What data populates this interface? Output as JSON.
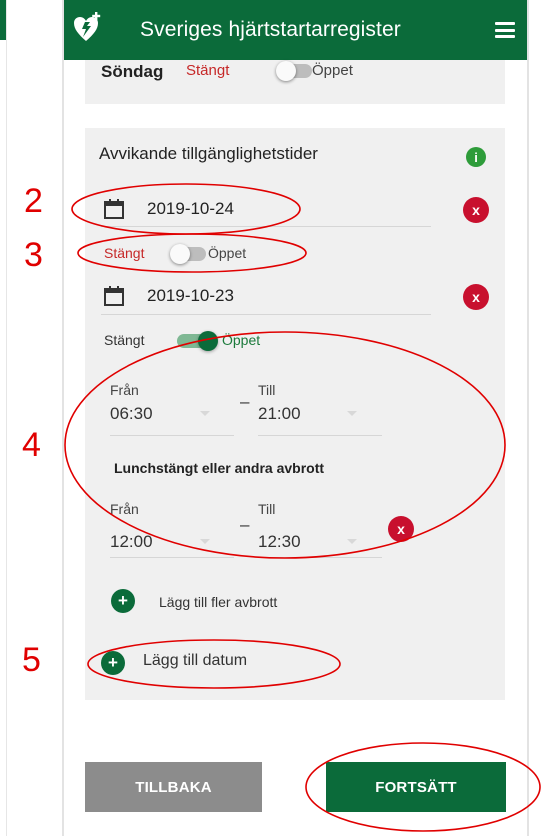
{
  "header": {
    "title": "Sveriges hjärtstartarregister"
  },
  "sunday": {
    "day": "Söndag",
    "closed": "Stängt",
    "open": "Öppet"
  },
  "deviating": {
    "heading": "Avvikande tillgänglighetstider",
    "entry1": {
      "date": "2019-10-24",
      "closed": "Stängt",
      "open": "Öppet"
    },
    "entry2": {
      "date": "2019-10-23",
      "closed": "Stängt",
      "open": "Öppet",
      "from_label": "Från",
      "from_value": "06:30",
      "to_label": "Till",
      "to_value": "21:00",
      "lunch_heading": "Lunchstängt eller andra avbrott",
      "break_from_label": "Från",
      "break_from_value": "12:00",
      "break_to_label": "Till",
      "break_to_value": "12:30",
      "add_break": "Lägg till fler avbrott"
    },
    "add_date": "Lägg till datum"
  },
  "buttons": {
    "back": "TILLBAKA",
    "next": "FORTSÄTT"
  },
  "annotations": {
    "n2": "2",
    "n3": "3",
    "n4": "4",
    "n5": "5"
  },
  "icons": {
    "remove": "x",
    "add": "+",
    "info": "i",
    "dash": "–"
  },
  "colors": {
    "brand_green": "#0b6b3a",
    "closed_red": "#c62828",
    "remove_red": "#c8102e",
    "annotation_red": "#e00000"
  }
}
